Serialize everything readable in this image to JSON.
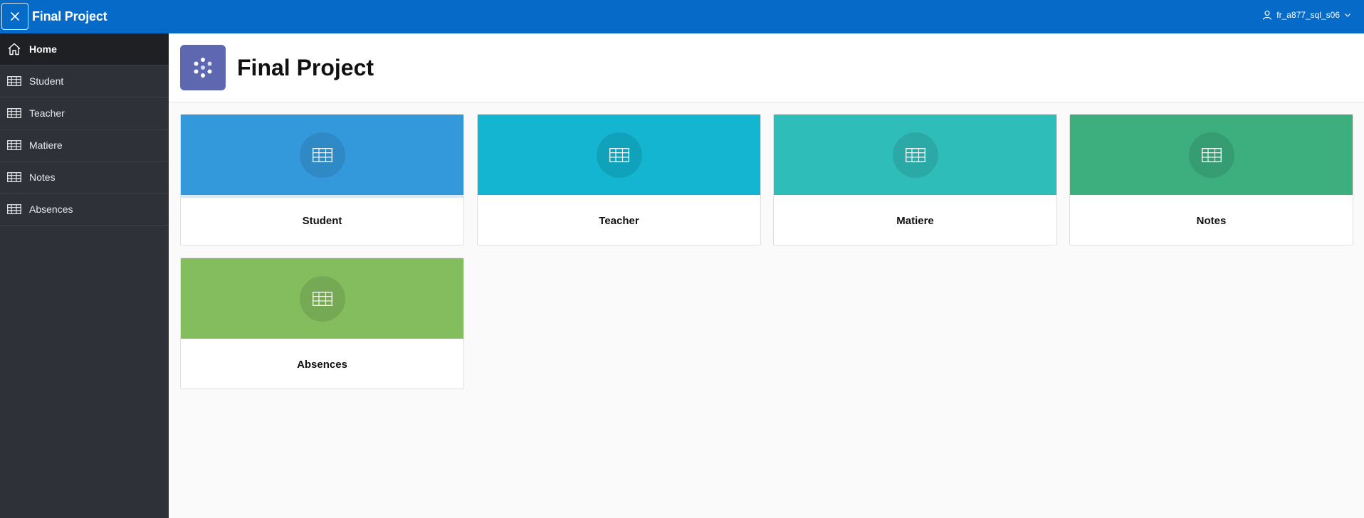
{
  "header": {
    "app_title": "Final Project",
    "user_name": "fr_a877_sql_s06",
    "icons": {
      "toggle": "close-icon",
      "user": "user-icon",
      "chevron": "chevron-down-icon"
    },
    "color": "#056ac8"
  },
  "sidebar": {
    "items": [
      {
        "label": "Home",
        "icon": "home-icon",
        "active": true
      },
      {
        "label": "Student",
        "icon": "table-icon"
      },
      {
        "label": "Teacher",
        "icon": "table-icon"
      },
      {
        "label": "Matiere",
        "icon": "table-icon"
      },
      {
        "label": "Notes",
        "icon": "table-icon"
      },
      {
        "label": "Absences",
        "icon": "table-icon"
      }
    ]
  },
  "page": {
    "title": "Final Project",
    "logo_icon": "app-logo-icon",
    "logo_color": "#5d68b0"
  },
  "cards": [
    {
      "label": "Student",
      "color": "#3499db",
      "icon": "table-icon"
    },
    {
      "label": "Teacher",
      "color": "#14b5d1",
      "icon": "table-icon"
    },
    {
      "label": "Matiere",
      "color": "#2fbdb9",
      "icon": "table-icon"
    },
    {
      "label": "Notes",
      "color": "#3daf7f",
      "icon": "table-icon"
    },
    {
      "label": "Absences",
      "color": "#84bd5e",
      "icon": "table-icon"
    }
  ]
}
